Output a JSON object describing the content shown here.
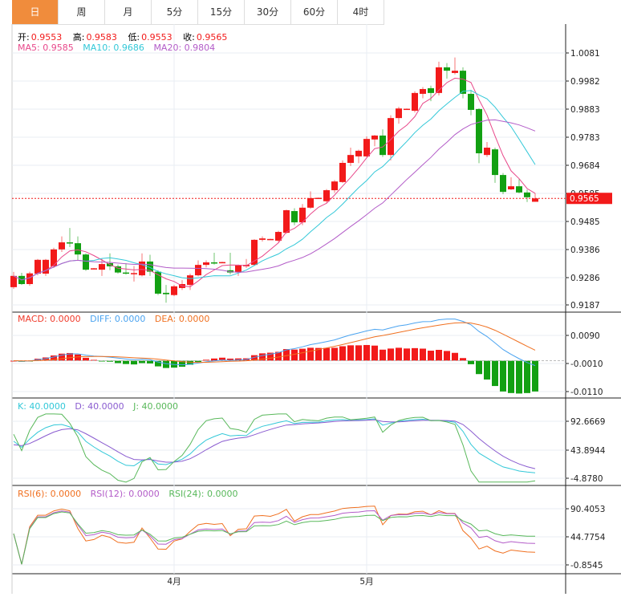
{
  "tabs": [
    "日",
    "周",
    "月",
    "5分",
    "15分",
    "30分",
    "60分",
    "4时"
  ],
  "active_tab": 0,
  "ohlc_header": {
    "open_label": "开:",
    "open": "0.9553",
    "high_label": "高:",
    "high": "0.9583",
    "low_label": "低:",
    "low": "0.9553",
    "close_label": "收:",
    "close": "0.9565"
  },
  "ma_header": {
    "ma5": "MA5: 0.9585",
    "ma10": "MA10: 0.9686",
    "ma20": "MA20: 0.9804"
  },
  "macd_header": {
    "macd": "MACD: 0.0000",
    "diff": "DIFF: 0.0000",
    "dea": "DEA: 0.0000"
  },
  "kdj_header": {
    "k": "K: 40.0000",
    "d": "D: 40.0000",
    "j": "J: 40.0000"
  },
  "rsi_header": {
    "rsi6": "RSI(6): 0.0000",
    "rsi12": "RSI(12): 0.0000",
    "rsi24": "RSI(24): 0.0000"
  },
  "price_axis": [
    "1.0081",
    "0.9982",
    "0.9883",
    "0.9783",
    "0.9684",
    "0.9585",
    "0.9485",
    "0.9386",
    "0.9286",
    "0.9187"
  ],
  "current_price": "0.9565",
  "macd_axis": [
    "0.0090",
    "-0.0010",
    "-0.0110"
  ],
  "kdj_axis": [
    "92.6669",
    "43.8944",
    "-4.8780"
  ],
  "rsi_axis": [
    "90.4053",
    "44.7754",
    "-0.8545"
  ],
  "x_axis": [
    {
      "label": "4月",
      "index": 20
    },
    {
      "label": "5月",
      "index": 44
    }
  ],
  "colors": {
    "up": "#f21a1a",
    "down": "#12a012",
    "ma5": "#e8488a",
    "ma10": "#33c8d8",
    "ma20": "#b35cc8",
    "diff": "#4aa3f0",
    "dea": "#f07020",
    "k": "#33c8d8",
    "d": "#8a5cd0",
    "j": "#58b85a",
    "rsi6": "#f07020",
    "rsi12": "#b35cc8",
    "rsi24": "#58b85a"
  },
  "chart_data": {
    "type": "candlestick",
    "price_range": [
      0.9187,
      1.0081
    ],
    "ohlc": [
      [
        0.925,
        0.929,
        0.9304,
        0.9244
      ],
      [
        0.929,
        0.9261,
        0.9301,
        0.9258
      ],
      [
        0.9261,
        0.9299,
        0.9305,
        0.9255
      ],
      [
        0.9298,
        0.9347,
        0.935,
        0.9292
      ],
      [
        0.9298,
        0.9347,
        0.935,
        0.929
      ],
      [
        0.9324,
        0.9384,
        0.939,
        0.9318
      ],
      [
        0.9384,
        0.9409,
        0.943,
        0.9375
      ],
      [
        0.9409,
        0.9406,
        0.946,
        0.9392
      ],
      [
        0.9406,
        0.9366,
        0.943,
        0.9345
      ],
      [
        0.9366,
        0.9312,
        0.937,
        0.9308
      ],
      [
        0.9315,
        0.9317,
        0.9318,
        0.9313
      ],
      [
        0.9312,
        0.9332,
        0.935,
        0.929
      ],
      [
        0.9335,
        0.9324,
        0.937,
        0.931
      ],
      [
        0.9324,
        0.9302,
        0.933,
        0.9298
      ],
      [
        0.9302,
        0.9298,
        0.9335,
        0.9295
      ],
      [
        0.9298,
        0.93,
        0.9325,
        0.927
      ],
      [
        0.9292,
        0.9341,
        0.937,
        0.9288
      ],
      [
        0.9341,
        0.9305,
        0.9365,
        0.929
      ],
      [
        0.9305,
        0.9227,
        0.931,
        0.9222
      ],
      [
        0.923,
        0.9225,
        0.9258,
        0.9195
      ],
      [
        0.9222,
        0.9253,
        0.9258,
        0.9218
      ],
      [
        0.9247,
        0.9261,
        0.9275,
        0.924
      ],
      [
        0.9258,
        0.9292,
        0.9298,
        0.924
      ],
      [
        0.9292,
        0.9329,
        0.9345,
        0.9288
      ],
      [
        0.9329,
        0.9338,
        0.9345,
        0.932
      ],
      [
        0.9338,
        0.9335,
        0.9372,
        0.933
      ],
      [
        0.9337,
        0.9339,
        0.934,
        0.9336
      ],
      [
        0.931,
        0.9302,
        0.9372,
        0.9295
      ],
      [
        0.9302,
        0.9327,
        0.933,
        0.929
      ],
      [
        0.9324,
        0.9329,
        0.935,
        0.9318
      ],
      [
        0.9329,
        0.9418,
        0.942,
        0.9325
      ],
      [
        0.9418,
        0.9423,
        0.943,
        0.9412
      ],
      [
        0.942,
        0.9421,
        0.9422,
        0.9419
      ],
      [
        0.9415,
        0.9446,
        0.945,
        0.941
      ],
      [
        0.9443,
        0.9523,
        0.9525,
        0.944
      ],
      [
        0.952,
        0.948,
        0.953,
        0.947
      ],
      [
        0.948,
        0.9532,
        0.9545,
        0.947
      ],
      [
        0.9532,
        0.9566,
        0.959,
        0.9528
      ],
      [
        0.9565,
        0.9567,
        0.9568,
        0.9564
      ],
      [
        0.9555,
        0.9594,
        0.9598,
        0.955
      ],
      [
        0.9594,
        0.9625,
        0.963,
        0.9585
      ],
      [
        0.9623,
        0.9691,
        0.97,
        0.962
      ],
      [
        0.9691,
        0.9719,
        0.9745,
        0.968
      ],
      [
        0.9714,
        0.9734,
        0.9738,
        0.969
      ],
      [
        0.9714,
        0.9776,
        0.9785,
        0.9712
      ],
      [
        0.9774,
        0.9788,
        0.979,
        0.975
      ],
      [
        0.9788,
        0.9719,
        0.981,
        0.9712
      ],
      [
        0.9719,
        0.985,
        0.986,
        0.97
      ],
      [
        0.985,
        0.9884,
        0.989,
        0.983
      ],
      [
        0.9881,
        0.9883,
        0.9884,
        0.988
      ],
      [
        0.9876,
        0.9939,
        0.9945,
        0.987
      ],
      [
        0.9936,
        0.9953,
        0.996,
        0.992
      ],
      [
        0.9956,
        0.9939,
        0.9965,
        0.991
      ],
      [
        0.9939,
        1.003,
        1.005,
        0.993
      ],
      [
        1.003,
        1.0018,
        1.0045,
        0.999
      ],
      [
        1.001,
        1.0018,
        1.0065,
        1.0005
      ],
      [
        1.0018,
        0.9936,
        1.003,
        0.992
      ],
      [
        0.9936,
        0.9879,
        0.995,
        0.986
      ],
      [
        0.9882,
        0.9725,
        0.9885,
        0.969
      ],
      [
        0.9719,
        0.9745,
        0.9765,
        0.9712
      ],
      [
        0.9739,
        0.9648,
        0.9745,
        0.962
      ],
      [
        0.9648,
        0.9588,
        0.9655,
        0.958
      ],
      [
        0.9597,
        0.9608,
        0.964,
        0.9595
      ],
      [
        0.9608,
        0.9586,
        0.9633,
        0.9583
      ],
      [
        0.9586,
        0.9569,
        0.9596,
        0.9552
      ],
      [
        0.9553,
        0.9565,
        0.9583,
        0.9553
      ]
    ]
  }
}
